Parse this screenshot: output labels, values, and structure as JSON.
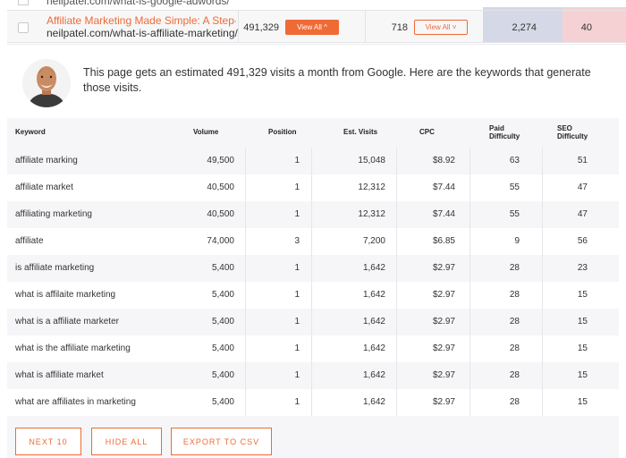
{
  "previous_row": {
    "url": "neilpatel.com/what-is-google-adwords/"
  },
  "current_row": {
    "title": "Affiliate Marketing Made Simple: A Step-by-Ste...",
    "url": "neilpatel.com/what-is-affiliate-marketing/",
    "visits": "491,329",
    "view_all_1": "View All ^",
    "backlinks": "718",
    "view_all_2": "View All ˅",
    "domain_score": "2,274",
    "social": "40"
  },
  "summary_text": "This page gets an estimated 491,329 visits a month from Google. Here are the keywords that generate those visits.",
  "keyword_table": {
    "headers": {
      "keyword": "Keyword",
      "volume": "Volume",
      "position": "Position",
      "est_visits": "Est. Visits",
      "cpc": "CPC",
      "paid_l1": "Paid",
      "paid_l2": "Difficulty",
      "seo_l1": "SEO",
      "seo_l2": "Difficulty"
    },
    "rows": [
      {
        "keyword": "affiliate marking",
        "volume": "49,500",
        "position": "1",
        "visits": "15,048",
        "cpc": "$8.92",
        "paid": "63",
        "seo": "51"
      },
      {
        "keyword": "affiliate market",
        "volume": "40,500",
        "position": "1",
        "visits": "12,312",
        "cpc": "$7.44",
        "paid": "55",
        "seo": "47"
      },
      {
        "keyword": "affiliating marketing",
        "volume": "40,500",
        "position": "1",
        "visits": "12,312",
        "cpc": "$7.44",
        "paid": "55",
        "seo": "47"
      },
      {
        "keyword": "affiliate",
        "volume": "74,000",
        "position": "3",
        "visits": "7,200",
        "cpc": "$6.85",
        "paid": "9",
        "seo": "56"
      },
      {
        "keyword": "is affiliate marketing",
        "volume": "5,400",
        "position": "1",
        "visits": "1,642",
        "cpc": "$2.97",
        "paid": "28",
        "seo": "23"
      },
      {
        "keyword": "what is affilaite marketing",
        "volume": "5,400",
        "position": "1",
        "visits": "1,642",
        "cpc": "$2.97",
        "paid": "28",
        "seo": "15"
      },
      {
        "keyword": "what is a affiliate marketer",
        "volume": "5,400",
        "position": "1",
        "visits": "1,642",
        "cpc": "$2.97",
        "paid": "28",
        "seo": "15"
      },
      {
        "keyword": "what is the affiliate marketing",
        "volume": "5,400",
        "position": "1",
        "visits": "1,642",
        "cpc": "$2.97",
        "paid": "28",
        "seo": "15"
      },
      {
        "keyword": "what is affiliate market",
        "volume": "5,400",
        "position": "1",
        "visits": "1,642",
        "cpc": "$2.97",
        "paid": "28",
        "seo": "15"
      },
      {
        "keyword": "what are affiliates in marketing",
        "volume": "5,400",
        "position": "1",
        "visits": "1,642",
        "cpc": "$2.97",
        "paid": "28",
        "seo": "15"
      }
    ]
  },
  "footer": {
    "next": "NEXT 10",
    "hide": "HIDE ALL",
    "export": "EXPORT TO CSV"
  },
  "colors": {
    "accent": "#f06a35",
    "panel_bg": "#f6f6f9",
    "domain_col": "#d5d8e6",
    "social_col": "#f5d1d4"
  }
}
